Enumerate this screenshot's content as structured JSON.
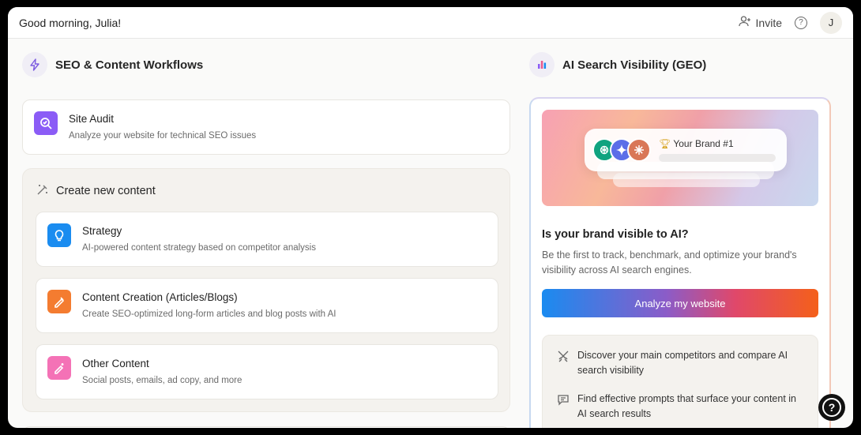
{
  "header": {
    "greeting": "Good morning, Julia!",
    "invite_label": "Invite",
    "avatar_initial": "J"
  },
  "workflows": {
    "title": "SEO & Content Workflows",
    "site_audit": {
      "title": "Site Audit",
      "desc": "Analyze your website for technical SEO issues"
    },
    "create": {
      "title": "Create new content",
      "items": [
        {
          "title": "Strategy",
          "desc": "AI-powered content strategy based on competitor analysis",
          "color": "#1a8cf0"
        },
        {
          "title": "Content Creation (Articles/Blogs)",
          "desc": "Create SEO-optimized long-form articles and blog posts with AI",
          "color": "#f47c30"
        },
        {
          "title": "Other Content",
          "desc": "Social posts, emails, ad copy, and more",
          "color": "#f472b6"
        }
      ]
    }
  },
  "geo": {
    "title": "AI Search Visibility (GEO)",
    "banner_brand": "Your Brand #1",
    "question": "Is your brand visible to AI?",
    "description": "Be the first to track, benchmark, and optimize your brand's visibility across AI search engines.",
    "cta_label": "Analyze my website",
    "features": [
      "Discover your main competitors and compare AI search visibility",
      "Find effective prompts that surface your content in AI search results"
    ]
  },
  "colors": {
    "site_audit_tile": "#8b5cf6",
    "accent_purple": "#8b5cf6"
  }
}
